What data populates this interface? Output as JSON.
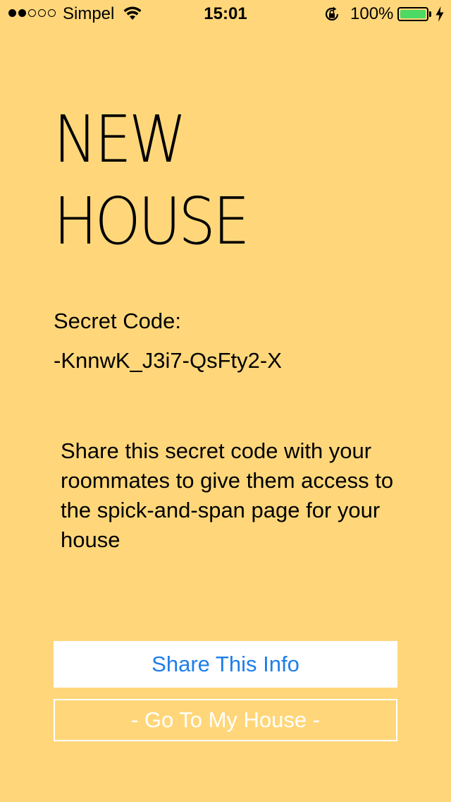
{
  "colors": {
    "background": "#FFD77A",
    "share_button_text": "#1E7EE8",
    "battery_fill": "#4CD964"
  },
  "status_bar": {
    "signal_bars_filled": 2,
    "signal_bars_total": 5,
    "carrier": "Simpel",
    "time": "15:01",
    "battery_percent": "100%",
    "battery_level": 1.0,
    "icons": [
      "wifi-icon",
      "orientation-lock-icon",
      "battery-icon",
      "charging-bolt-icon"
    ]
  },
  "title": {
    "line1": "NEW",
    "line2": "HOUSE"
  },
  "secret": {
    "label": "Secret Code:",
    "value": "-KnnwK_J3i7-QsFty2-X"
  },
  "description": "Share this secret code with your roommates to give them access to the spick-and-span page for your house",
  "buttons": {
    "share": "Share This Info",
    "go_house": "- Go To My House -"
  }
}
